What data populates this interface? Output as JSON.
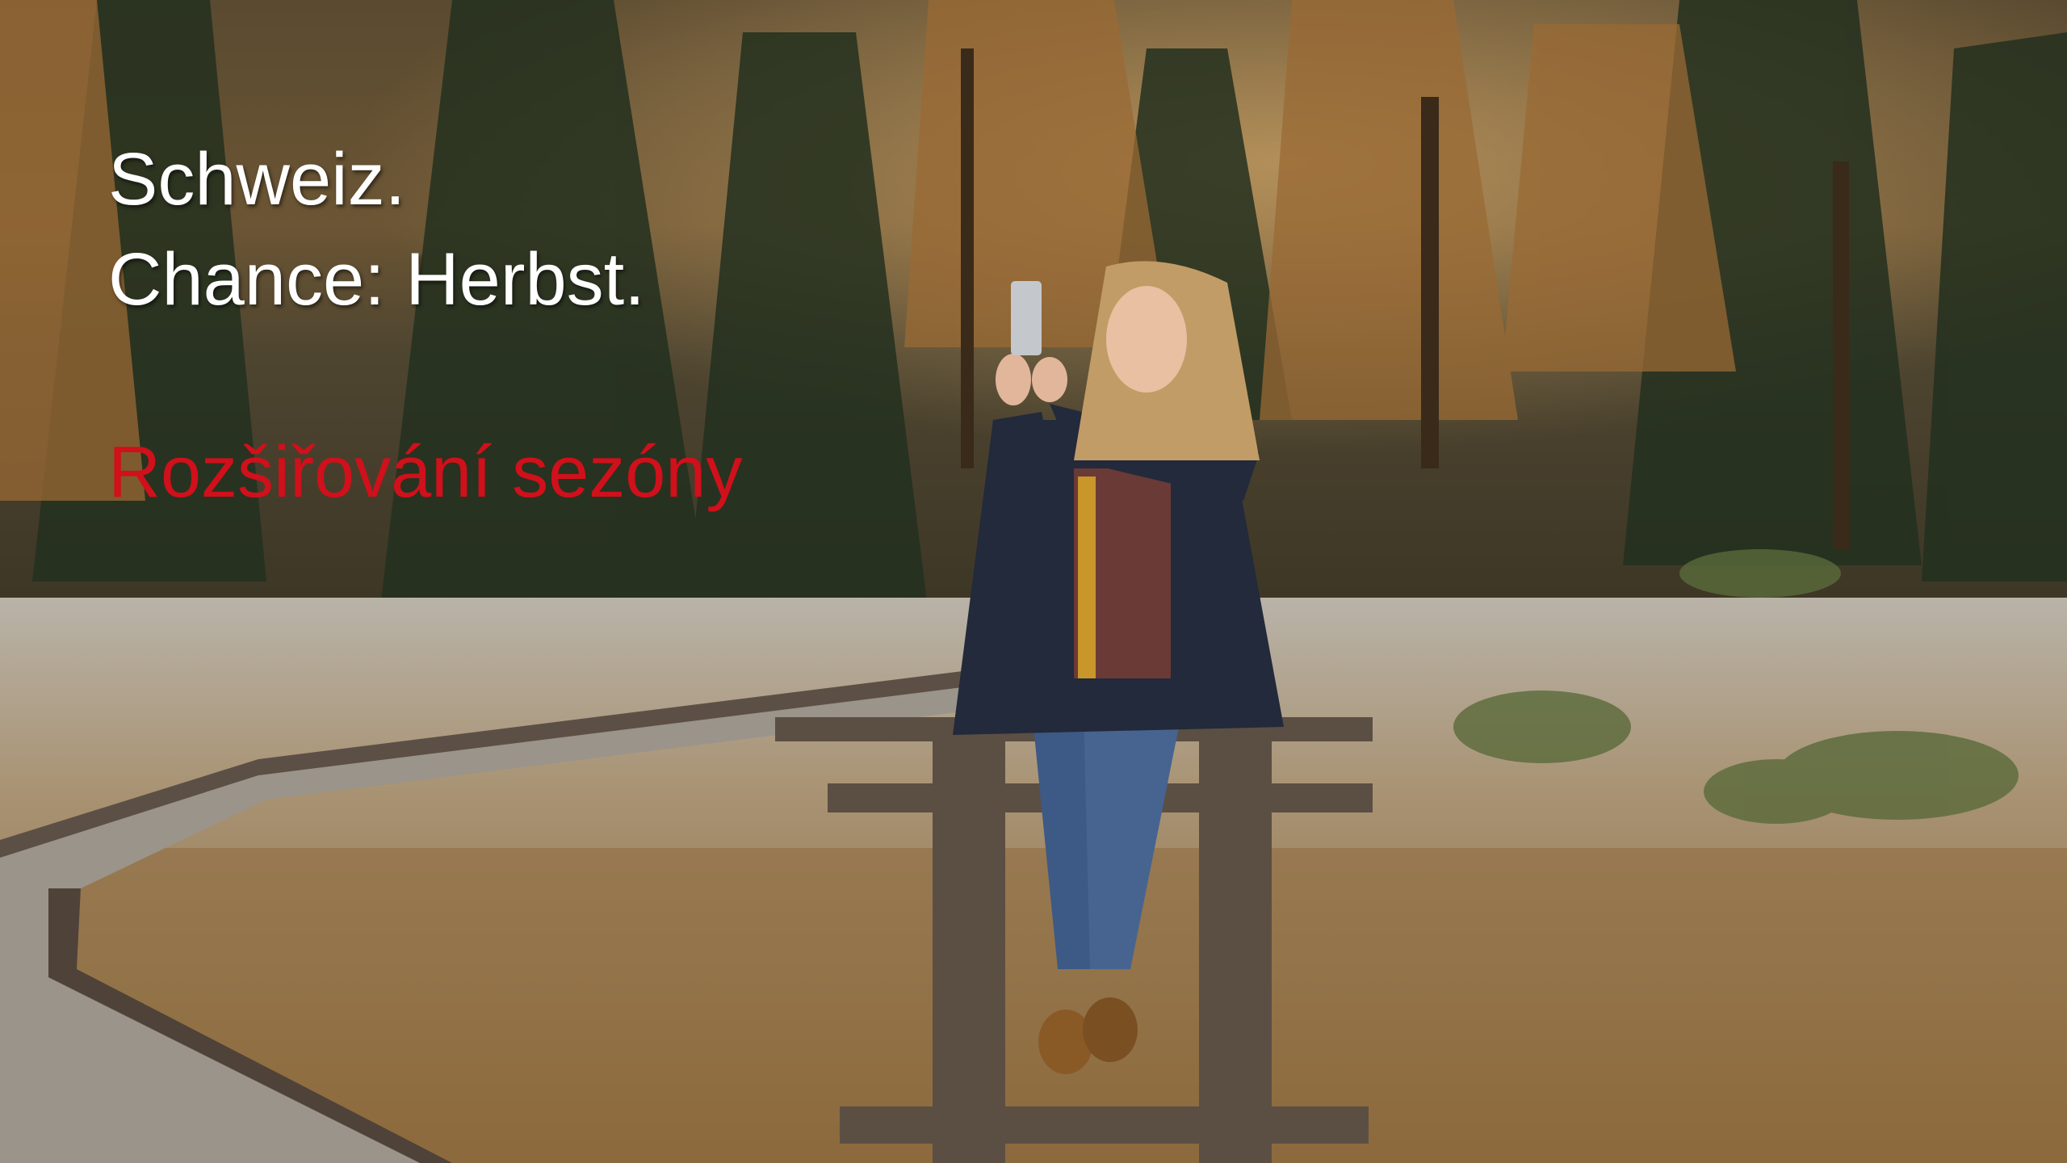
{
  "slide": {
    "title_line_1": "Schweiz.",
    "title_line_2": "Chance: Herbst.",
    "subtitle": "Rozšiřování sezóny"
  },
  "colors": {
    "title": "#ffffff",
    "subtitle": "#d0101b"
  }
}
